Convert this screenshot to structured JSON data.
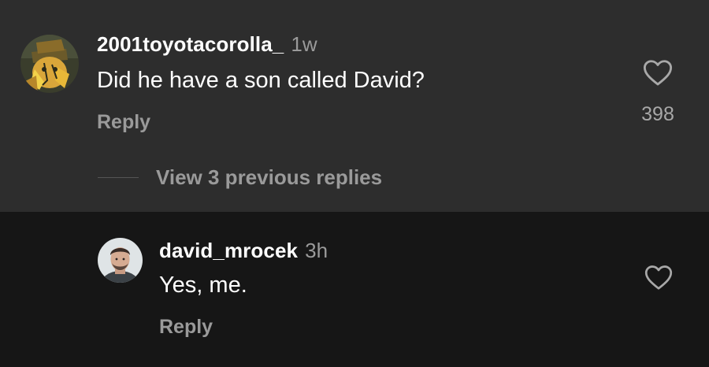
{
  "comment": {
    "username": "2001toyotacorolla_",
    "time": "1w",
    "text": "Did he have a son called David?",
    "reply_label": "Reply",
    "like_count": "398",
    "avatar_icon": "cartoon-avatar",
    "heart_icon": "heart-outline-icon"
  },
  "view_replies": {
    "label": "View 3 previous replies"
  },
  "reply_comment": {
    "username": "david_mrocek",
    "time": "3h",
    "text": "Yes, me.",
    "reply_label": "Reply",
    "avatar_icon": "photo-avatar",
    "heart_icon": "heart-outline-icon"
  },
  "colors": {
    "top_bg": "#2d2d2d",
    "bottom_bg": "#161616",
    "muted_text": "#9a9a9a",
    "primary_text": "#ffffff"
  }
}
